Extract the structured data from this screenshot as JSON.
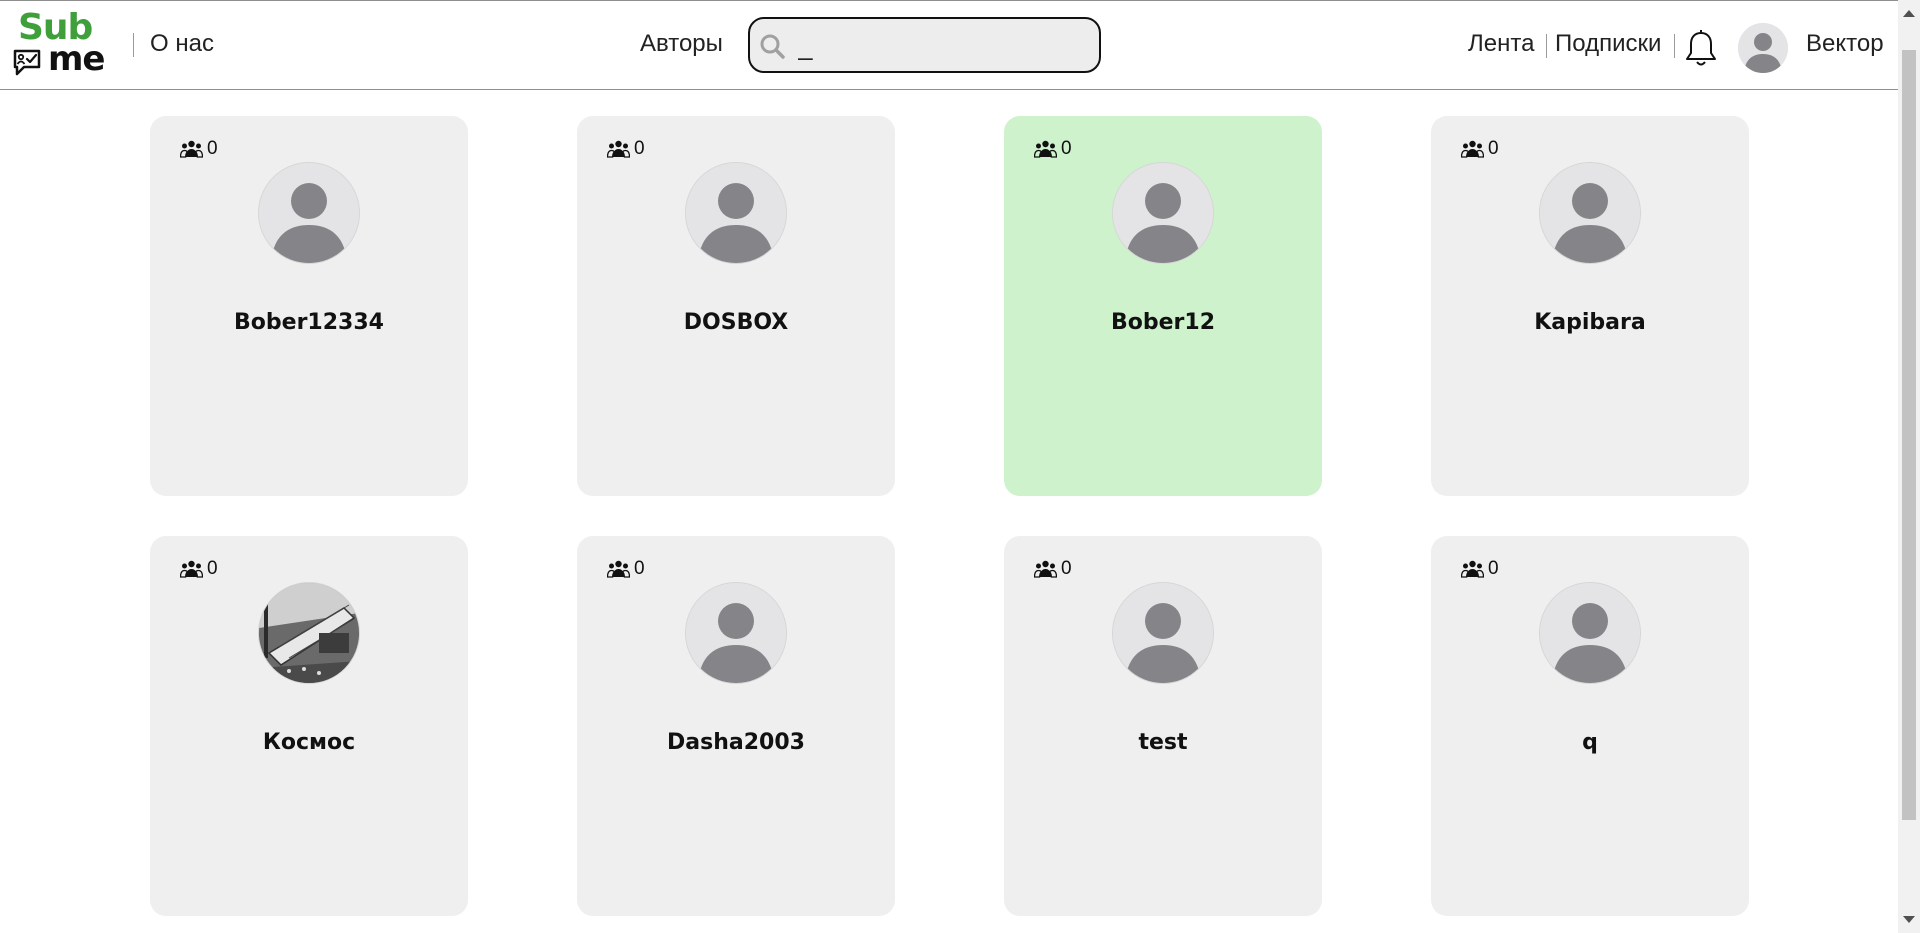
{
  "header": {
    "logo_top": "Sub",
    "logo_bottom": "me",
    "about_label": "О нас",
    "authors_label": "Авторы",
    "search": {
      "value": "_",
      "placeholder": ""
    },
    "feed_label": "Лента",
    "subscriptions_label": "Подписки",
    "username": "Вектор"
  },
  "colors": {
    "brand_green": "#3f9f3b",
    "card_bg": "#efefef",
    "card_active_bg": "#cdf2cc"
  },
  "authors": [
    {
      "name": "Bober12334",
      "subscribers": "0",
      "avatar": "default-avatar",
      "active": false
    },
    {
      "name": "DOSBOX",
      "subscribers": "0",
      "avatar": "default-avatar",
      "active": false
    },
    {
      "name": "Bober12",
      "subscribers": "0",
      "avatar": "default-avatar",
      "active": true
    },
    {
      "name": "Kapibara",
      "subscribers": "0",
      "avatar": "default-avatar",
      "active": false
    },
    {
      "name": "Космос",
      "subscribers": "0",
      "avatar": "photo-avatar",
      "active": false
    },
    {
      "name": "Dasha2003",
      "subscribers": "0",
      "avatar": "default-avatar",
      "active": false
    },
    {
      "name": "test",
      "subscribers": "0",
      "avatar": "default-avatar",
      "active": false
    },
    {
      "name": "q",
      "subscribers": "0",
      "avatar": "default-avatar",
      "active": false
    }
  ]
}
